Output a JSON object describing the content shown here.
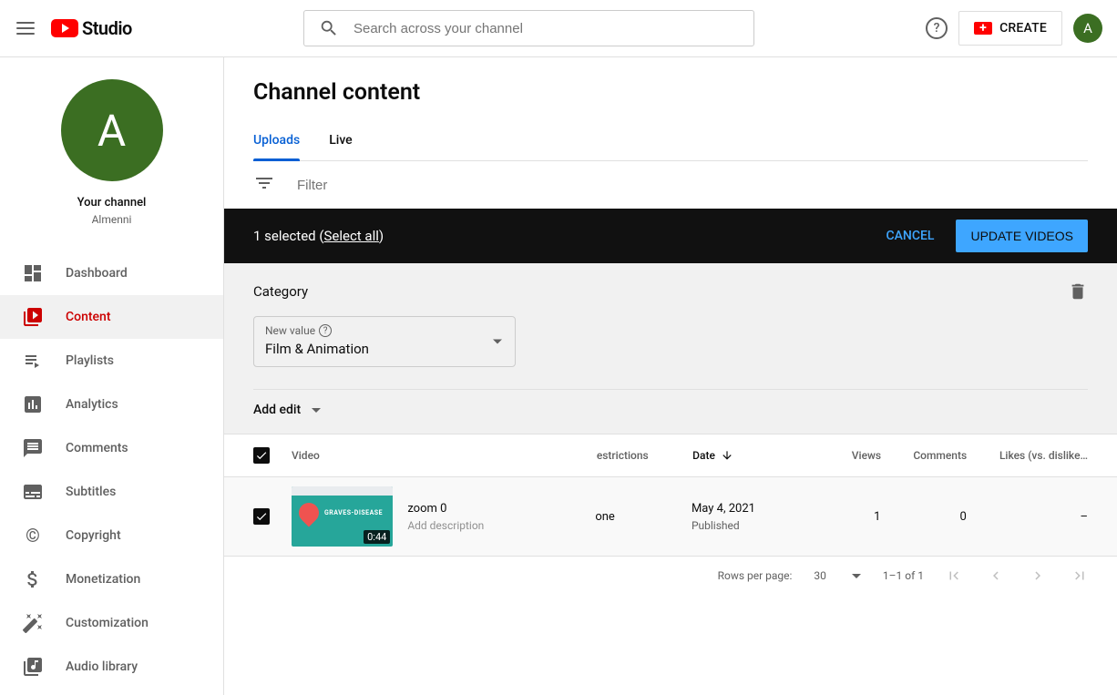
{
  "header": {
    "logo_text": "Studio",
    "search_placeholder": "Search across your channel",
    "create_label": "CREATE",
    "avatar_letter": "A"
  },
  "sidebar": {
    "channel_avatar_letter": "A",
    "channel_label": "Your channel",
    "channel_name": "Almenni",
    "items": [
      {
        "label": "Dashboard"
      },
      {
        "label": "Content"
      },
      {
        "label": "Playlists"
      },
      {
        "label": "Analytics"
      },
      {
        "label": "Comments"
      },
      {
        "label": "Subtitles"
      },
      {
        "label": "Copyright"
      },
      {
        "label": "Monetization"
      },
      {
        "label": "Customization"
      },
      {
        "label": "Audio library"
      }
    ]
  },
  "page": {
    "title": "Channel content",
    "tabs": [
      {
        "label": "Uploads"
      },
      {
        "label": "Live"
      }
    ],
    "filter_placeholder": "Filter"
  },
  "selection": {
    "count_text": "1 selected",
    "select_all_label": "Select all",
    "cancel_label": "CANCEL",
    "update_label": "UPDATE VIDEOS"
  },
  "edit_panel": {
    "label": "Category",
    "new_value_label": "New value",
    "selected_value": "Film & Animation",
    "add_edit_label": "Add edit"
  },
  "table": {
    "headers": {
      "video": "Video",
      "restrictions": "estrictions",
      "date": "Date",
      "views": "Views",
      "comments": "Comments",
      "likes": "Likes (vs. dislike…"
    },
    "rows": [
      {
        "title": "zoom 0",
        "description_placeholder": "Add description",
        "duration": "0:44",
        "thumb_text": "GRAVES-DISEASE",
        "restrictions": "one",
        "date": "May 4, 2021",
        "date_status": "Published",
        "views": "1",
        "comments": "0",
        "likes": "–"
      }
    ]
  },
  "pagination": {
    "rows_per_page_label": "Rows per page:",
    "rows_per_page_value": "30",
    "range_text": "1–1 of 1"
  }
}
